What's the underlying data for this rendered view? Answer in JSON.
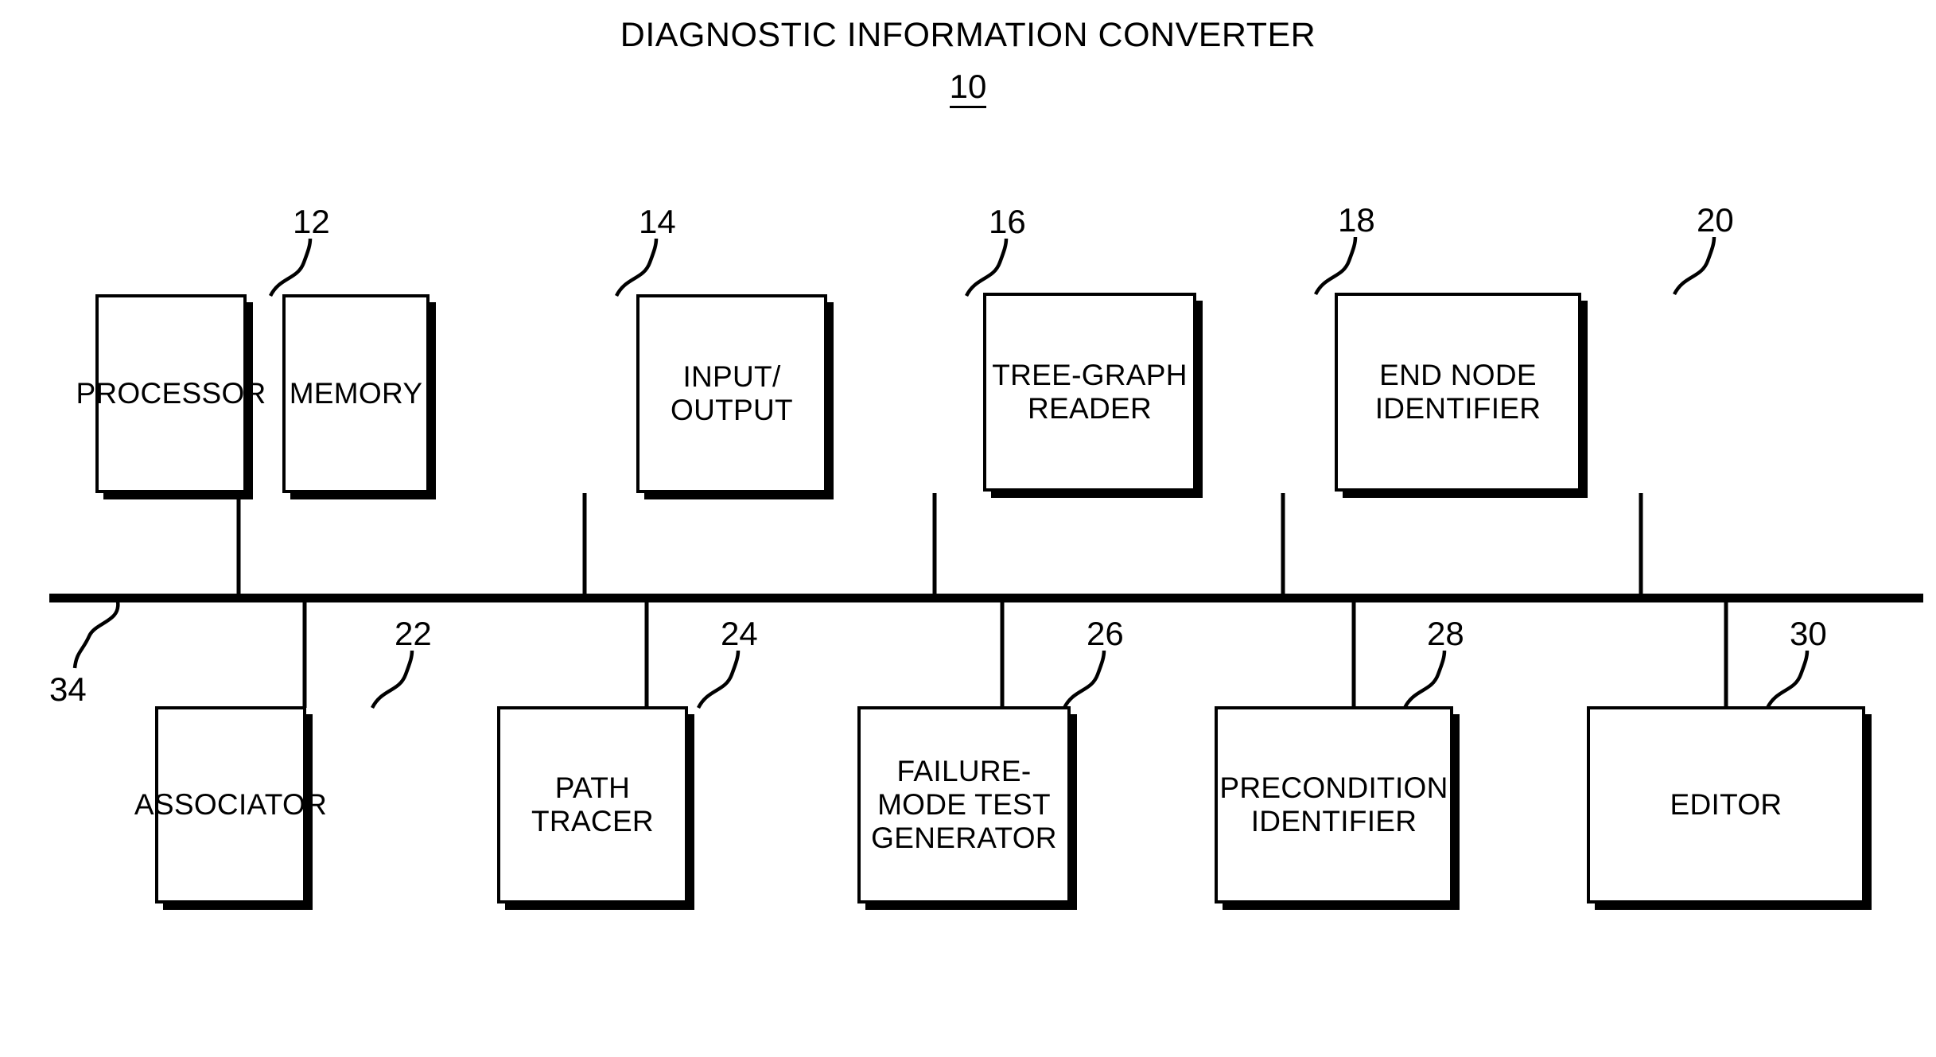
{
  "figure": {
    "title": "DIAGNOSTIC INFORMATION CONVERTER",
    "title_ref": "10",
    "bus_ref": "34"
  },
  "top_row": [
    {
      "label": "PROCESSOR",
      "ref": "12"
    },
    {
      "label": "MEMORY",
      "ref": "14"
    },
    {
      "label": "INPUT/\nOUTPUT",
      "ref": "16"
    },
    {
      "label": "TREE-GRAPH\nREADER",
      "ref": "18"
    },
    {
      "label": "END NODE\nIDENTIFIER",
      "ref": "20"
    }
  ],
  "bottom_row": [
    {
      "label": "ASSOCIATOR",
      "ref": "22"
    },
    {
      "label": "PATH\nTRACER",
      "ref": "24"
    },
    {
      "label": "FAILURE-\nMODE TEST\nGENERATOR",
      "ref": "26"
    },
    {
      "label": "PRECONDITION\nIDENTIFIER",
      "ref": "28"
    },
    {
      "label": "EDITOR",
      "ref": "30"
    }
  ],
  "colors": {
    "ink": "#000000",
    "paper": "#ffffff"
  }
}
